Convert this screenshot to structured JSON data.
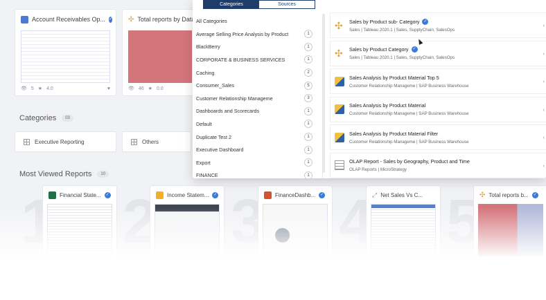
{
  "top_cards": [
    {
      "title": "Account Receivables Op...",
      "views": "5",
      "rating": "4.0"
    },
    {
      "title": "Total reports by Data",
      "views": "46",
      "rating": "0.0"
    }
  ],
  "categories_section": {
    "title": "Categories",
    "count": "03",
    "tiles": [
      "Executive Reporting",
      "Others"
    ]
  },
  "most_viewed": {
    "title": "Most Viewed Reports",
    "count": "10",
    "cards": [
      {
        "rank": "1",
        "title": "Financial State...",
        "color": "#1d7145"
      },
      {
        "rank": "2",
        "title": "Income Statem...",
        "color": "#f2b02a"
      },
      {
        "rank": "3",
        "title": "FinanceDashb...",
        "color": "#d35230"
      },
      {
        "rank": "4",
        "title": "Net Sales Vs C...",
        "color": "#8a8f99"
      },
      {
        "rank": "5",
        "title": "Total reports b...",
        "color": "#e0a33a"
      }
    ]
  },
  "dropdown": {
    "tabs": {
      "categories": "Categories",
      "sources": "Sources"
    },
    "categories": [
      {
        "label": "All Categories",
        "count": ""
      },
      {
        "label": "Average Selling Price Analysis by Product",
        "count": "1"
      },
      {
        "label": "BlackBerry",
        "count": "1"
      },
      {
        "label": "CORPORATE & BUSINESS SERVICES",
        "count": "1"
      },
      {
        "label": "Caching",
        "count": "2"
      },
      {
        "label": "Consumer_Sales",
        "count": "5"
      },
      {
        "label": "Customer Relationship Manageme",
        "count": "3"
      },
      {
        "label": "Dashboards and Scorecards",
        "count": "1"
      },
      {
        "label": "Default",
        "count": "1"
      },
      {
        "label": "Duplicate Test 2",
        "count": "1"
      },
      {
        "label": "Executive Dashboard",
        "count": "1"
      },
      {
        "label": "Export",
        "count": "1"
      },
      {
        "label": "FINANCE",
        "count": "1"
      }
    ],
    "results": [
      {
        "title": "Sales by Product sub- Category",
        "sub": "Sales | Tableau 2020.1 | Sales, SupplyChain, SalesOps",
        "verified": true,
        "icon": "tableau"
      },
      {
        "title": "Sales by Product Category",
        "sub": "Sales | Tableau 2020.1 | Sales, SupplyChain, SalesOps",
        "verified": true,
        "icon": "tableau"
      },
      {
        "title": "Sales Analysis by Product Material Top 5",
        "sub": "Customer Relationship Manageme | SAP Business Warehouse",
        "verified": false,
        "icon": "sap"
      },
      {
        "title": "Sales Analysis by Product Material",
        "sub": "Customer Relationship Manageme | SAP Business Warehouse",
        "verified": false,
        "icon": "sap"
      },
      {
        "title": "Sales Analysis by Product Material Filter",
        "sub": "Customer Relationship Manageme | SAP Business Warehouse",
        "verified": false,
        "icon": "sap"
      },
      {
        "title": "OLAP Report - Sales by Geography, Product and Time",
        "sub": "OLAP Reports | MicroStrategy",
        "verified": false,
        "icon": "grid"
      }
    ]
  },
  "colors": {
    "accent": "#1f3d6b",
    "verified": "#3a7bd5"
  }
}
